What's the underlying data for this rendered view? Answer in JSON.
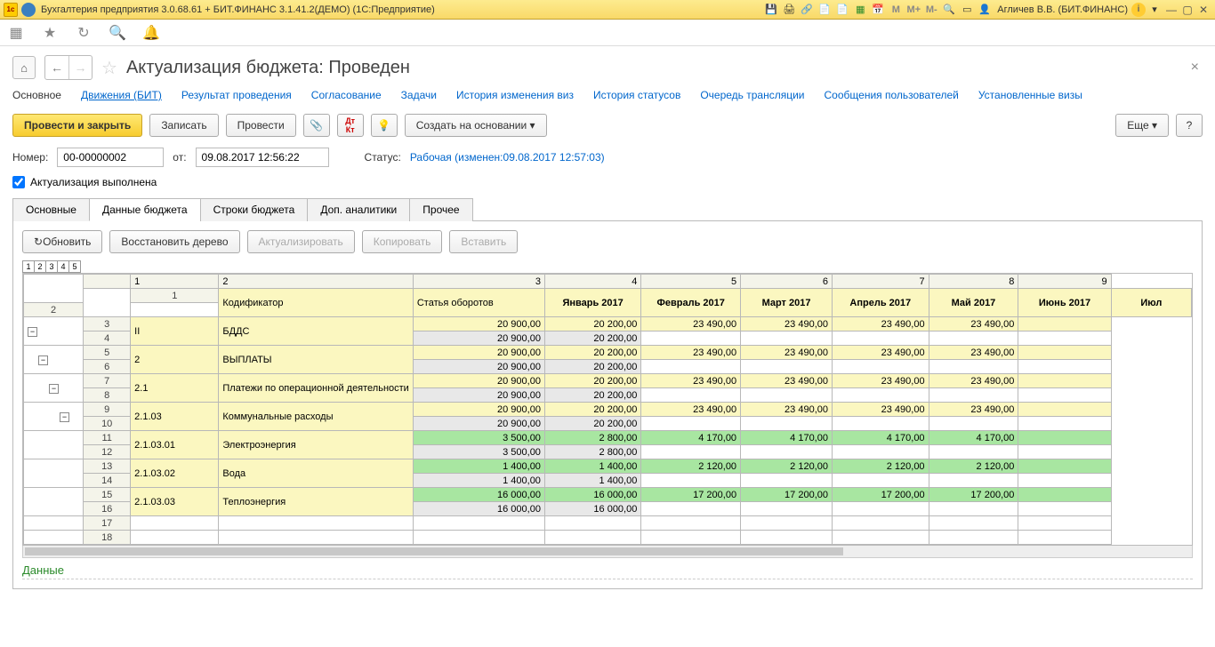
{
  "titlebar": {
    "title": "Бухгалтерия предприятия 3.0.68.61 + БИТ.ФИНАНС 3.1.41.2(ДЕМО)  (1С:Предприятие)",
    "user": "Агличев В.В. (БИТ.ФИНАНС)",
    "m": "M",
    "mplus": "M+",
    "mminus": "M-"
  },
  "doc": {
    "title": "Актуализация бюджета: Проведен"
  },
  "link_tabs": [
    "Основное",
    "Движения (БИТ)",
    "Результат проведения",
    "Согласование",
    "Задачи",
    "История изменения виз",
    "История статусов",
    "Очередь трансляции",
    "Сообщения пользователей",
    "Установленные визы"
  ],
  "buttons": {
    "post_close": "Провести и закрыть",
    "save": "Записать",
    "post": "Провести",
    "create_based": "Создать на основании",
    "more": "Еще",
    "help": "?"
  },
  "fields": {
    "num_label": "Номер:",
    "num_value": "00-00000002",
    "from_label": "от:",
    "from_value": "09.08.2017 12:56:22",
    "status_label": "Статус:",
    "status_value": "Рабочая (изменен:09.08.2017 12:57:03)"
  },
  "checkbox_label": "Актуализация выполнена",
  "inner_tabs": [
    "Основные",
    "Данные бюджета",
    "Строки бюджета",
    "Доп. аналитики",
    "Прочее"
  ],
  "grid_toolbar": {
    "refresh": "Обновить",
    "restore": "Восстановить дерево",
    "actualize": "Актуализировать",
    "copy": "Копировать",
    "paste": "Вставить"
  },
  "grid": {
    "col_headers": {
      "kod": "Кодификатор",
      "art": "Статья оборотов"
    },
    "months": [
      "Январь 2017",
      "Февраль 2017",
      "Март 2017",
      "Апрель 2017",
      "Май 2017",
      "Июнь 2017",
      "Июл"
    ],
    "month_nums": [
      "1",
      "2",
      "3",
      "4",
      "5",
      "6",
      "7"
    ],
    "rows": [
      {
        "r1": 1,
        "r2": 2,
        "kod": "",
        "art": "",
        "row1": [
          "",
          "",
          "",
          "",
          "",
          "",
          ""
        ],
        "row2": [
          "",
          "",
          "",
          "",
          "",
          "",
          ""
        ],
        "c1": "yel",
        "c2": "yel",
        "hdr": true
      },
      {
        "r1": 3,
        "r2": 4,
        "kod": "II",
        "art": "БДДС",
        "row1": [
          "20 900,00",
          "20 200,00",
          "23 490,00",
          "23 490,00",
          "23 490,00",
          "23 490,00",
          ""
        ],
        "row2": [
          "20 900,00",
          "20 200,00",
          "",
          "",
          "",
          "",
          ""
        ],
        "c1": "yel",
        "c2": "gry"
      },
      {
        "r1": 5,
        "r2": 6,
        "kod": "2",
        "art": "ВЫПЛАТЫ",
        "row1": [
          "20 900,00",
          "20 200,00",
          "23 490,00",
          "23 490,00",
          "23 490,00",
          "23 490,00",
          ""
        ],
        "row2": [
          "20 900,00",
          "20 200,00",
          "",
          "",
          "",
          "",
          ""
        ],
        "c1": "yel",
        "c2": "gry"
      },
      {
        "r1": 7,
        "r2": 8,
        "kod": "2.1",
        "art": "Платежи по операционной деятельности",
        "row1": [
          "20 900,00",
          "20 200,00",
          "23 490,00",
          "23 490,00",
          "23 490,00",
          "23 490,00",
          ""
        ],
        "row2": [
          "20 900,00",
          "20 200,00",
          "",
          "",
          "",
          "",
          ""
        ],
        "c1": "yel",
        "c2": "gry"
      },
      {
        "r1": 9,
        "r2": 10,
        "kod": "2.1.03",
        "art": "Коммунальные расходы",
        "row1": [
          "20 900,00",
          "20 200,00",
          "23 490,00",
          "23 490,00",
          "23 490,00",
          "23 490,00",
          ""
        ],
        "row2": [
          "20 900,00",
          "20 200,00",
          "",
          "",
          "",
          "",
          ""
        ],
        "c1": "yel",
        "c2": "gry"
      },
      {
        "r1": 11,
        "r2": 12,
        "kod": "2.1.03.01",
        "art": "Электроэнергия",
        "row1": [
          "3 500,00",
          "2 800,00",
          "4 170,00",
          "4 170,00",
          "4 170,00",
          "4 170,00",
          ""
        ],
        "row2": [
          "3 500,00",
          "2 800,00",
          "",
          "",
          "",
          "",
          ""
        ],
        "c1": "grn",
        "c2": "gry"
      },
      {
        "r1": 13,
        "r2": 14,
        "kod": "2.1.03.02",
        "art": "Вода",
        "row1": [
          "1 400,00",
          "1 400,00",
          "2 120,00",
          "2 120,00",
          "2 120,00",
          "2 120,00",
          ""
        ],
        "row2": [
          "1 400,00",
          "1 400,00",
          "",
          "",
          "",
          "",
          ""
        ],
        "c1": "grn",
        "c2": "gry"
      },
      {
        "r1": 15,
        "r2": 16,
        "kod": "2.1.03.03",
        "art": "Теплоэнергия",
        "row1": [
          "16 000,00",
          "16 000,00",
          "17 200,00",
          "17 200,00",
          "17 200,00",
          "17 200,00",
          ""
        ],
        "row2": [
          "16 000,00",
          "16 000,00",
          "",
          "",
          "",
          "",
          ""
        ],
        "c1": "grn",
        "c2": "gry"
      }
    ],
    "empty_rows": [
      17,
      18
    ]
  },
  "bottom": {
    "title": "Данные"
  }
}
